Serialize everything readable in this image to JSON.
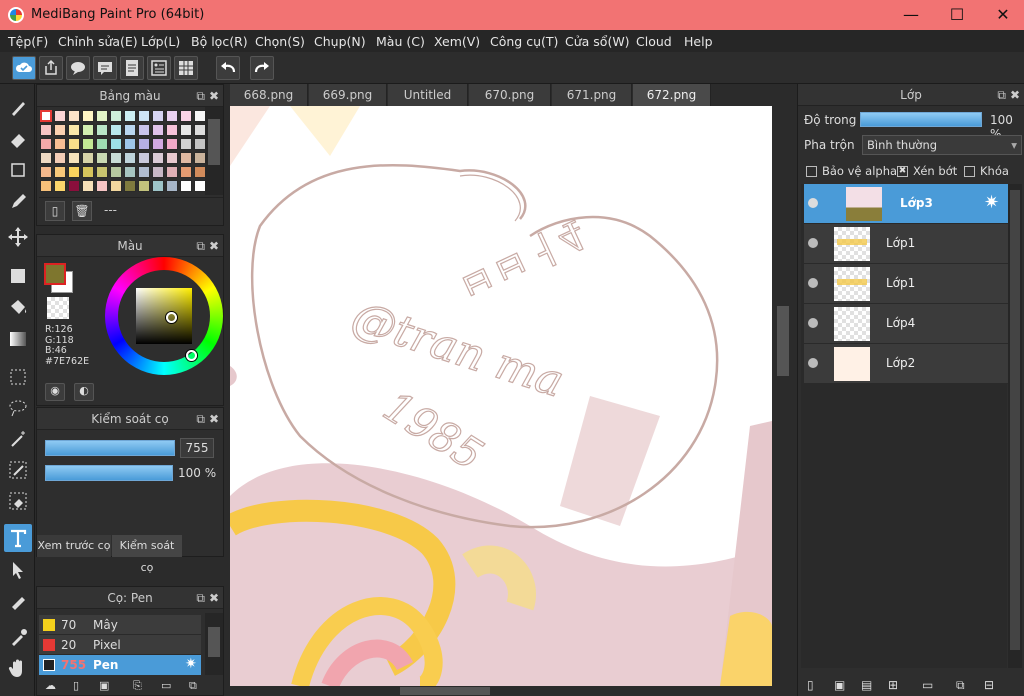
{
  "window": {
    "title": "MediBang Paint Pro (64bit)",
    "minimize": "—",
    "maximize": "☐",
    "close": "✕"
  },
  "menu": [
    "Tệp(F)",
    "Chỉnh sửa(E)",
    "Lớp(L)",
    "Bộ lọc(R)",
    "Chọn(S)",
    "Chụp(N)",
    "Màu (C)",
    "Xem(V)",
    "Công cụ(T)",
    "Cửa sổ(W)",
    "Cloud",
    "Help"
  ],
  "toolbar": {
    "icons": [
      "cloud-check-icon",
      "share-icon",
      "speech-bubble-icon",
      "comment-icon",
      "document-icon",
      "material-icon",
      "grid-icon"
    ],
    "undo": "undo-icon",
    "redo": "redo-icon"
  },
  "tools": [
    "brush-icon",
    "eraser-icon",
    "rectangle-icon",
    "pen-icon",
    "move-icon",
    "fill-rect-icon",
    "bucket-icon",
    "gradient-icon",
    "marquee-icon",
    "lasso-icon",
    "magic-wand-icon",
    "select-pen-icon",
    "select-eraser-icon",
    "text-icon",
    "operation-icon",
    "dropper-pen-icon",
    "eyedropper-icon",
    "hand-icon"
  ],
  "palette_panel": {
    "title": "Bảng màu",
    "swatch_label": "---",
    "colors": [
      "#ffffff",
      "#fcd5d5",
      "#fde3c8",
      "#fff6c4",
      "#e2f5c7",
      "#cdeed9",
      "#cdeff3",
      "#cde3f5",
      "#d6d4f2",
      "#ead2f1",
      "#fbd3e6",
      "#f6f6f6",
      "#f7c4c4",
      "#fbd1b1",
      "#fbe8a9",
      "#d3efb1",
      "#b9e6c8",
      "#b8e8ed",
      "#b9d6f0",
      "#c8c4ec",
      "#dfc2ea",
      "#f7c3da",
      "#e8e8e8",
      "#dddddd",
      "#f4a9a9",
      "#f8bd93",
      "#f8dd8a",
      "#c2e894",
      "#9fdcb2",
      "#9de0e7",
      "#9ec6ea",
      "#b5afe4",
      "#d1a9e1",
      "#f2a9c9",
      "#d0d0d0",
      "#c4c4c4",
      "#efd9c2",
      "#f3ccb5",
      "#f6e2bb",
      "#d7d3a7",
      "#c9d9b2",
      "#c9ddd6",
      "#bfd4db",
      "#c9c9dc",
      "#dacbd6",
      "#e8c9cf",
      "#e0b9a2",
      "#c9b29b",
      "#f5b98d",
      "#f8c87a",
      "#f9d35e",
      "#d6c45c",
      "#c9c46f",
      "#b7c9a0",
      "#a6c4c0",
      "#b0bcd0",
      "#c8b8c6",
      "#e0b0b6",
      "#e59c72",
      "#d18b5b",
      "#f6c07a",
      "#fbd56b",
      "#8a0f3c",
      "#f6e0b8",
      "#f7c5c5",
      "#f1d69e",
      "#7f7a3e",
      "#c2c27d",
      "#9ec5c9",
      "#a8b7c9",
      "#ffffff",
      "#ffffff"
    ]
  },
  "color_panel": {
    "title": "Màu",
    "primary": "#7E762E",
    "r": "R:126",
    "g": "G:118",
    "b": "B:46",
    "hex": "#7E762E"
  },
  "brush_control": {
    "title": "Kiểm soát cọ",
    "size": "755",
    "opacity": "100 %"
  },
  "left_tabs": [
    "Xem trước cọ",
    "Kiểm soát cọ"
  ],
  "brush_list": {
    "title": "Cọ: Pen",
    "items": [
      {
        "size": "70",
        "name": "Mây",
        "color": "#f4d01c"
      },
      {
        "size": "20",
        "name": "Pixel",
        "color": "#e53935"
      },
      {
        "size": "755",
        "name": "Pen",
        "color": "#222222"
      }
    ]
  },
  "doc_tabs": [
    "668.png",
    "669.png",
    "Untitled",
    "670.png",
    "671.png",
    "672.png"
  ],
  "canvas": {
    "line1": "ㅂㅂㅓ4",
    "line2": "@tran ma",
    "line3": "1985"
  },
  "layer_panel": {
    "title": "Lớp",
    "opacity_label": "Độ trong",
    "opacity_value": "100 %",
    "blend_label": "Pha trộn",
    "blend_value": "Bình thường",
    "protect_alpha": "Bảo vệ alpha",
    "clipping": "Xén bớt",
    "lock": "Khóa",
    "layers": [
      "Lớp3",
      "Lớp1",
      "Lớp1",
      "Lớp4",
      "Lớp2"
    ]
  }
}
